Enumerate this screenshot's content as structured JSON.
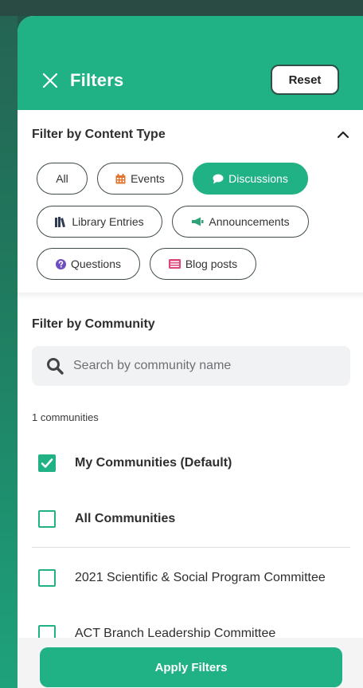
{
  "header": {
    "title": "Filters",
    "reset_label": "Reset"
  },
  "content_type": {
    "label": "Filter by Content Type",
    "chips": [
      {
        "label": "All",
        "icon": "",
        "active": false
      },
      {
        "label": "Events",
        "icon": "calendar-icon",
        "active": false
      },
      {
        "label": "Discussions",
        "icon": "speech-bubble-icon",
        "active": true
      },
      {
        "label": "Library Entries",
        "icon": "books-icon",
        "active": false
      },
      {
        "label": "Announcements",
        "icon": "megaphone-icon",
        "active": false
      },
      {
        "label": "Questions",
        "icon": "question-circle-icon",
        "active": false
      },
      {
        "label": "Blog posts",
        "icon": "newspaper-icon",
        "active": false
      }
    ]
  },
  "community": {
    "label": "Filter by Community",
    "search_placeholder": "Search by community name",
    "count_text": "1 communities",
    "options": [
      {
        "label": "My Communities (Default)",
        "checked": true
      },
      {
        "label": "All Communities",
        "checked": false
      },
      {
        "label": "2021 Scientific & Social Program Committee",
        "checked": false
      },
      {
        "label": "ACT Branch Leadership Committee",
        "checked": false
      }
    ]
  },
  "footer": {
    "apply_label": "Apply Filters"
  },
  "colors": {
    "accent": "#20b184",
    "chip_border": "#3e4b48",
    "events_icon": "#e0742d",
    "blog_icon": "#e0457a",
    "question_icon": "#6d4fc0"
  }
}
